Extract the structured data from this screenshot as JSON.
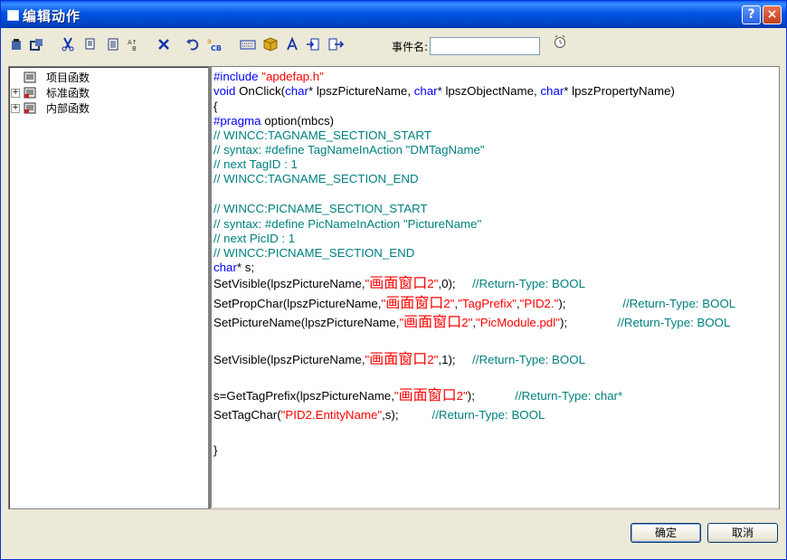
{
  "window": {
    "title": "编辑动作",
    "help_label": "?",
    "close_label": "×"
  },
  "toolbar": {
    "icons": [
      "paste-icon",
      "copy-format-icon",
      "cut-icon",
      "copy-icon",
      "paste-special-icon",
      "find-replace-icon",
      "delete-icon",
      "undo-icon",
      "compile-icon",
      "tag-icon",
      "object-icon",
      "lambda-icon",
      "import-icon",
      "export-icon"
    ],
    "event_name_label": "事件名:",
    "event_name_value": ""
  },
  "tree": {
    "items": [
      {
        "label": "项目函数",
        "expander": ""
      },
      {
        "label": "标准函数",
        "expander": "+"
      },
      {
        "label": "内部函数",
        "expander": "+"
      }
    ]
  },
  "code": {
    "lines": [
      [
        {
          "t": "#include ",
          "c": "kw"
        },
        {
          "t": "\"apdefap.h\"",
          "c": "str"
        }
      ],
      [
        {
          "t": "void ",
          "c": "kw"
        },
        {
          "t": "OnClick(",
          "c": ""
        },
        {
          "t": "char",
          "c": "kw"
        },
        {
          "t": "* lpszPictureName, ",
          "c": ""
        },
        {
          "t": "char",
          "c": "kw"
        },
        {
          "t": "* lpszObjectName, ",
          "c": ""
        },
        {
          "t": "char",
          "c": "kw"
        },
        {
          "t": "* lpszPropertyName)",
          "c": ""
        }
      ],
      [
        {
          "t": "{",
          "c": ""
        }
      ],
      [
        {
          "t": "#pragma ",
          "c": "kw"
        },
        {
          "t": "option(mbcs)",
          "c": ""
        }
      ],
      [
        {
          "t": "// WINCC:TAGNAME_SECTION_START",
          "c": "cm"
        }
      ],
      [
        {
          "t": "// syntax: #define TagNameInAction \"DMTagName\"",
          "c": "cm"
        }
      ],
      [
        {
          "t": "// next TagID : 1",
          "c": "cm"
        }
      ],
      [
        {
          "t": "// WINCC:TAGNAME_SECTION_END",
          "c": "cm"
        }
      ],
      [],
      [
        {
          "t": "// WINCC:PICNAME_SECTION_START",
          "c": "cm"
        }
      ],
      [
        {
          "t": "// syntax: #define PicNameInAction \"PictureName\"",
          "c": "cm"
        }
      ],
      [
        {
          "t": "// next PicID : 1",
          "c": "cm"
        }
      ],
      [
        {
          "t": "// WINCC:PICNAME_SECTION_END",
          "c": "cm"
        }
      ],
      [
        {
          "t": "char",
          "c": "kw"
        },
        {
          "t": "* s;",
          "c": ""
        }
      ],
      [
        {
          "t": "SetVisible(lpszPictureName,",
          "c": ""
        },
        {
          "t": "\"",
          "c": "str"
        },
        {
          "t": "画面窗口",
          "c": "zh"
        },
        {
          "t": "2\"",
          "c": "str"
        },
        {
          "t": ",0);     ",
          "c": ""
        },
        {
          "t": "//Return-Type: BOOL",
          "c": "cm"
        }
      ],
      [
        {
          "t": "SetPropChar(lpszPictureName,",
          "c": ""
        },
        {
          "t": "\"",
          "c": "str"
        },
        {
          "t": "画面窗口",
          "c": "zh"
        },
        {
          "t": "2\"",
          "c": "str"
        },
        {
          "t": ",",
          "c": ""
        },
        {
          "t": "\"TagPrefix\"",
          "c": "str"
        },
        {
          "t": ",",
          "c": ""
        },
        {
          "t": "\"PID2.\"",
          "c": "str"
        },
        {
          "t": ");                 ",
          "c": ""
        },
        {
          "t": "//Return-Type: BOOL",
          "c": "cm"
        }
      ],
      [
        {
          "t": "SetPictureName(lpszPictureName,",
          "c": ""
        },
        {
          "t": "\"",
          "c": "str"
        },
        {
          "t": "画面窗口",
          "c": "zh"
        },
        {
          "t": "2\"",
          "c": "str"
        },
        {
          "t": ",",
          "c": ""
        },
        {
          "t": "\"PicModule.pdl\"",
          "c": "str"
        },
        {
          "t": ");               ",
          "c": ""
        },
        {
          "t": "//Return-Type: BOOL",
          "c": "cm"
        }
      ],
      [],
      [
        {
          "t": "SetVisible(lpszPictureName,",
          "c": ""
        },
        {
          "t": "\"",
          "c": "str"
        },
        {
          "t": "画面窗口",
          "c": "zh"
        },
        {
          "t": "2\"",
          "c": "str"
        },
        {
          "t": ",1);     ",
          "c": ""
        },
        {
          "t": "//Return-Type: BOOL",
          "c": "cm"
        }
      ],
      [],
      [
        {
          "t": "s=GetTagPrefix(lpszPictureName,",
          "c": ""
        },
        {
          "t": "\"",
          "c": "str"
        },
        {
          "t": "画面窗口",
          "c": "zh"
        },
        {
          "t": "2\"",
          "c": "str"
        },
        {
          "t": ");            ",
          "c": ""
        },
        {
          "t": "//Return-Type: char*",
          "c": "cm"
        }
      ],
      [
        {
          "t": "SetTagChar(",
          "c": ""
        },
        {
          "t": "\"PID2.EntityName\"",
          "c": "str"
        },
        {
          "t": ",s);          ",
          "c": ""
        },
        {
          "t": "//Return-Type: BOOL",
          "c": "cm"
        }
      ],
      [],
      [
        {
          "t": "}",
          "c": ""
        }
      ]
    ]
  },
  "buttons": {
    "ok_label": "确定",
    "cancel_label": "取消"
  },
  "colors": {
    "titlebar": "#0054e3",
    "keyword": "#0000ff",
    "comment": "#008080",
    "string": "#ff0000"
  }
}
